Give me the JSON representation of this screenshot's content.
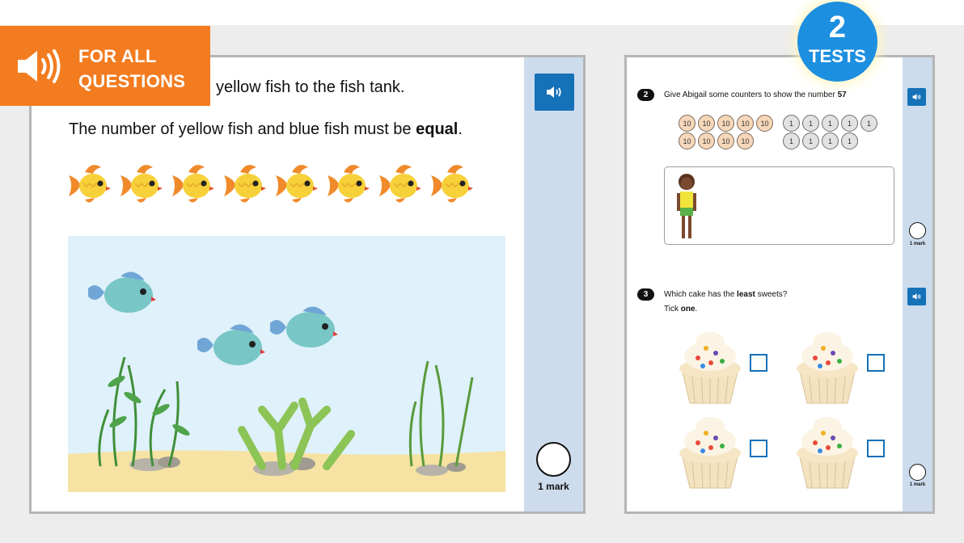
{
  "banner": {
    "icon": "speaker-icon",
    "line1": "FOR ALL",
    "line2": "QUESTIONS",
    "color": "#f37c20"
  },
  "tests_badge": {
    "number": "2",
    "label": "TESTS",
    "color": "#1d8fe0"
  },
  "left_page": {
    "question_line1": "yellow fish to the fish tank.",
    "question_line2_pre": "The number of yellow fish and blue fish must be ",
    "question_line2_bold": "equal",
    "question_line2_post": ".",
    "yellow_fish_count": 8,
    "tank_blue_fish_count": 3,
    "audio_icon": "speaker-icon",
    "mark_label": "1 mark"
  },
  "right_page": {
    "q2": {
      "number": "2",
      "text_pre": "Give Abigail some counters to show the number ",
      "text_bold": "57",
      "tens_counters": [
        "10",
        "10",
        "10",
        "10",
        "10",
        "10",
        "10",
        "10",
        "10"
      ],
      "ones_counters": [
        "1",
        "1",
        "1",
        "1",
        "1",
        "1",
        "1",
        "1",
        "1"
      ],
      "mark_label": "1 mark"
    },
    "q3": {
      "number": "3",
      "text_pre": "Which cake has the ",
      "text_bold": "least",
      "text_post": " sweets?",
      "instruction_pre": "Tick ",
      "instruction_bold": "one",
      "instruction_post": ".",
      "cakes": [
        "cake-a",
        "cake-b",
        "cake-c",
        "cake-d"
      ],
      "mark_label": "1 mark"
    },
    "accent_color": "#1571b8",
    "sidebar_color": "#cddced"
  }
}
